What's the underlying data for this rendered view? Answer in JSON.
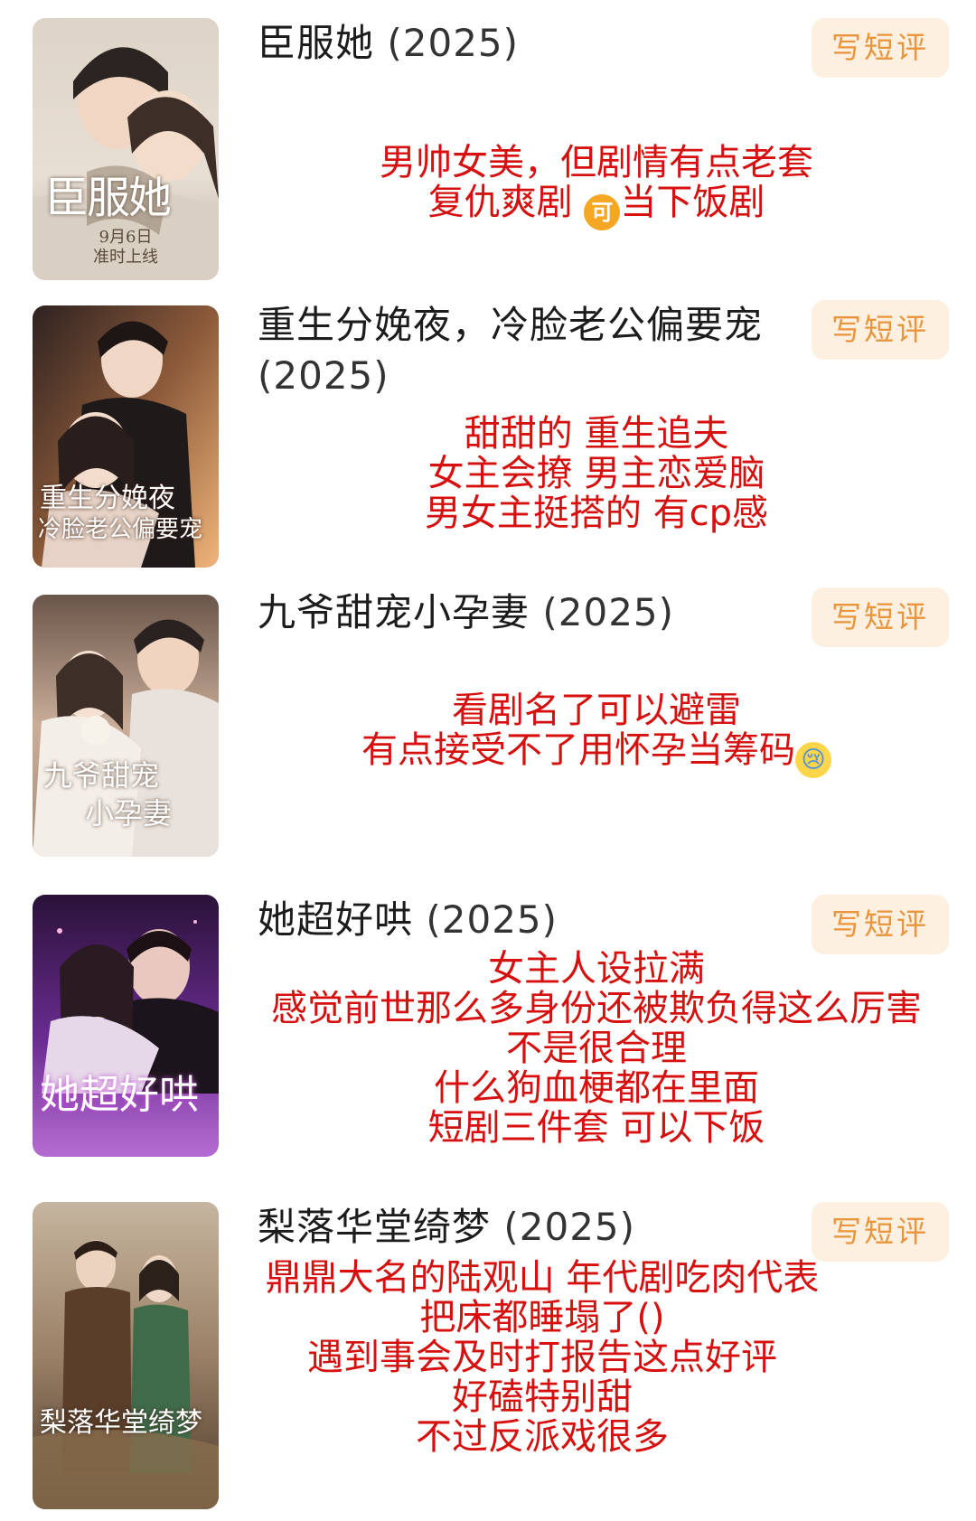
{
  "items": [
    {
      "title": "臣服她",
      "year": "(2025)",
      "button": "写短评",
      "poster": {
        "title_art": "臣服她",
        "caption_1": "9月6日",
        "caption_2": "准时上线",
        "colors": [
          "#e9dfd3",
          "#c7b8a6",
          "#8a7a68"
        ]
      },
      "review": [
        "男帅女美，但剧情有点老套",
        "复仇爽剧 ",
        "当下饭剧"
      ],
      "emoji": "可"
    },
    {
      "title": "重生分娩夜，冷脸老公偏要宠",
      "year": "(2025)",
      "button": "写短评",
      "poster": {
        "title_art_1": "重生分娩夜",
        "title_art_2": "冷脸老公偏要宠",
        "colors": [
          "#3a2a26",
          "#d9925a",
          "#f1c79a"
        ]
      },
      "review": [
        "甜甜的 重生追夫",
        "女主会撩 男主恋爱脑",
        "男女主挺搭的 有cp感"
      ]
    },
    {
      "title": "九爷甜宠小孕妻",
      "year": "(2025)",
      "button": "写短评",
      "poster": {
        "title_art_1": "九爷甜宠",
        "title_art_2": "小孕妻",
        "colors": [
          "#4a3a32",
          "#b89a86",
          "#e7d6c8"
        ]
      },
      "review": [
        "看剧名了可以避雷",
        "有点接受不了用怀孕当筹码"
      ],
      "emoji": "😢"
    },
    {
      "title": "她超好哄",
      "year": "(2025)",
      "button": "写短评",
      "poster": {
        "title_art": "她超好哄",
        "colors": [
          "#2a1240",
          "#7b3aa8",
          "#d08ae0"
        ]
      },
      "review": [
        "女主人设拉满",
        "感觉前世那么多身份还被欺负得这么厉害",
        "不是很合理",
        "什么狗血梗都在里面",
        "短剧三件套 可以下饭"
      ]
    },
    {
      "title": "梨落华堂绮梦",
      "year": "(2025)",
      "button": "写短评",
      "poster": {
        "title_art": "梨落华堂绮梦",
        "colors": [
          "#b9a68e",
          "#7a6148",
          "#3e3226"
        ]
      },
      "review": [
        "鼎鼎大名的陆观山 年代剧吃肉代表",
        "把床都睡塌了()",
        "遇到事会及时打报告这点好评",
        "好磕特别甜",
        "不过反派戏很多"
      ]
    }
  ]
}
